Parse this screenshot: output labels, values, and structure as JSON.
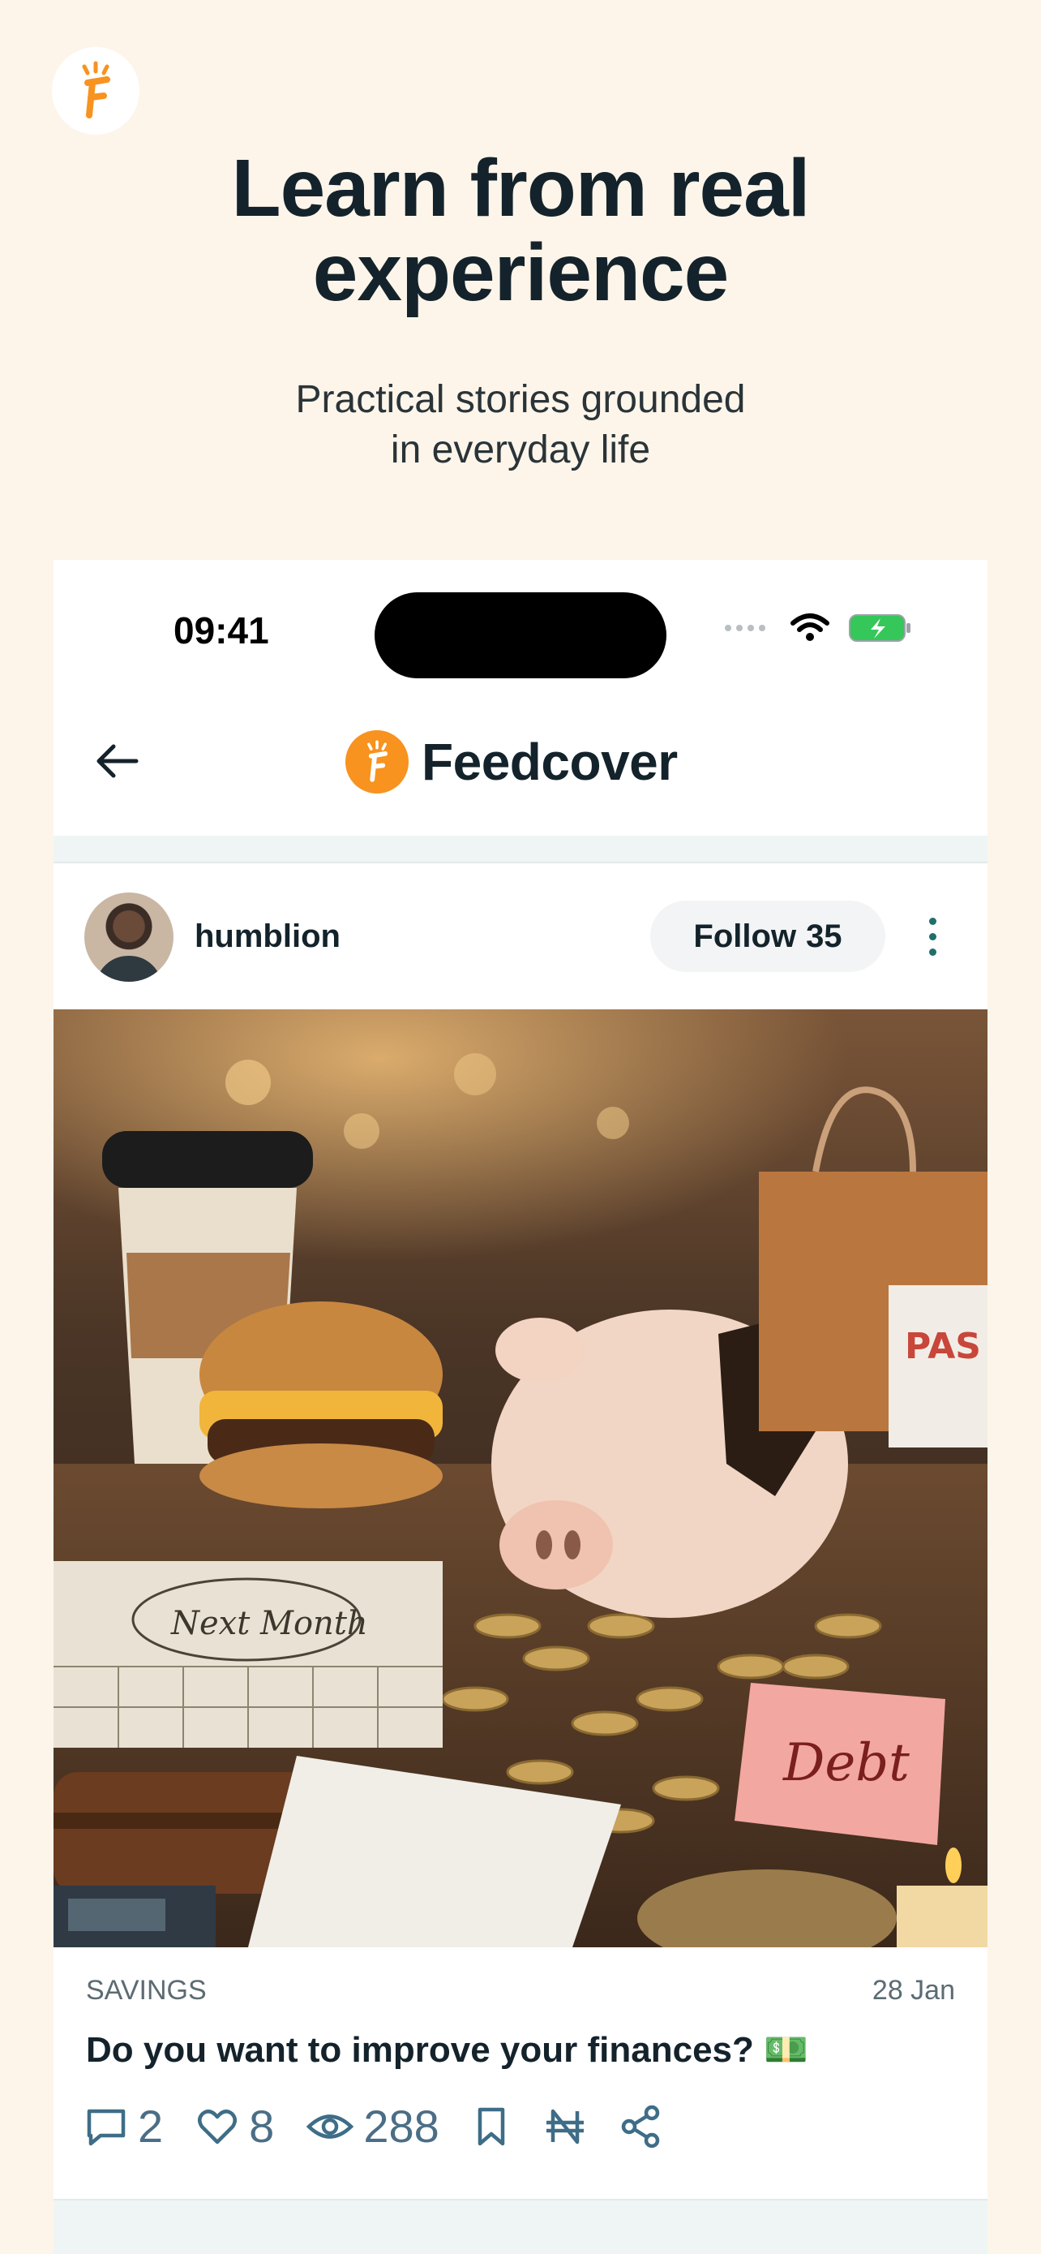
{
  "onboarding": {
    "title_line1": "Learn from real",
    "title_line2": "experience",
    "subtitle_line1": "Practical stories grounded",
    "subtitle_line2": "in everyday life"
  },
  "status_bar": {
    "time": "09:41"
  },
  "app": {
    "brand_name": "Feedcover"
  },
  "post": {
    "author": "humblion",
    "follow_label": "Follow",
    "follow_count": "35",
    "category": "SAVINGS",
    "date": "28 Jan",
    "title": "Do you want to improve your finances? 💵",
    "comments": "2",
    "likes": "8",
    "views": "288",
    "image_texts": {
      "calendar": "Next Month",
      "note": "Debt",
      "stamp": "PAS"
    }
  },
  "colors": {
    "background": "#fdf5ea",
    "brand_orange": "#f7931e",
    "icon_teal": "#1f6f6a",
    "action_blue": "#3e6d87"
  }
}
